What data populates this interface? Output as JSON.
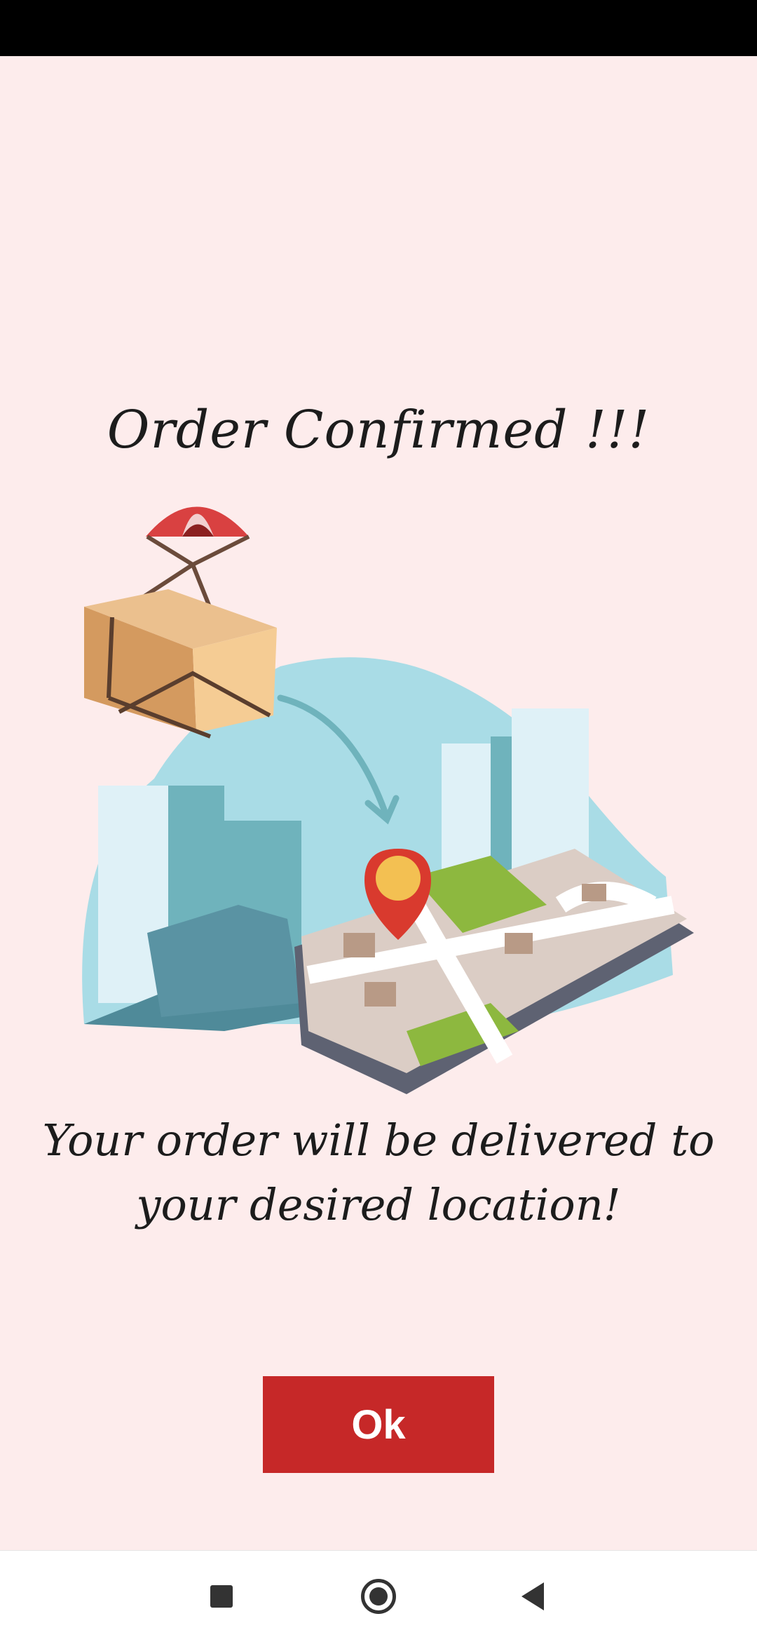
{
  "screen": {
    "title": "Order Confirmed !!!",
    "message": "Your order will be delivered to your desired location!",
    "ok_label": "Ok"
  },
  "colors": {
    "background": "#FDECEC",
    "button": "#C62828",
    "status_bar": "#000000"
  },
  "illustration": {
    "icons": [
      "parachute-icon",
      "package-box-icon",
      "curved-arrow-icon",
      "location-pin-icon",
      "smartphone-map-icon",
      "city-buildings-icon"
    ]
  },
  "nav_bar": {
    "icons": [
      "recent-apps-icon",
      "home-icon",
      "back-icon"
    ]
  }
}
